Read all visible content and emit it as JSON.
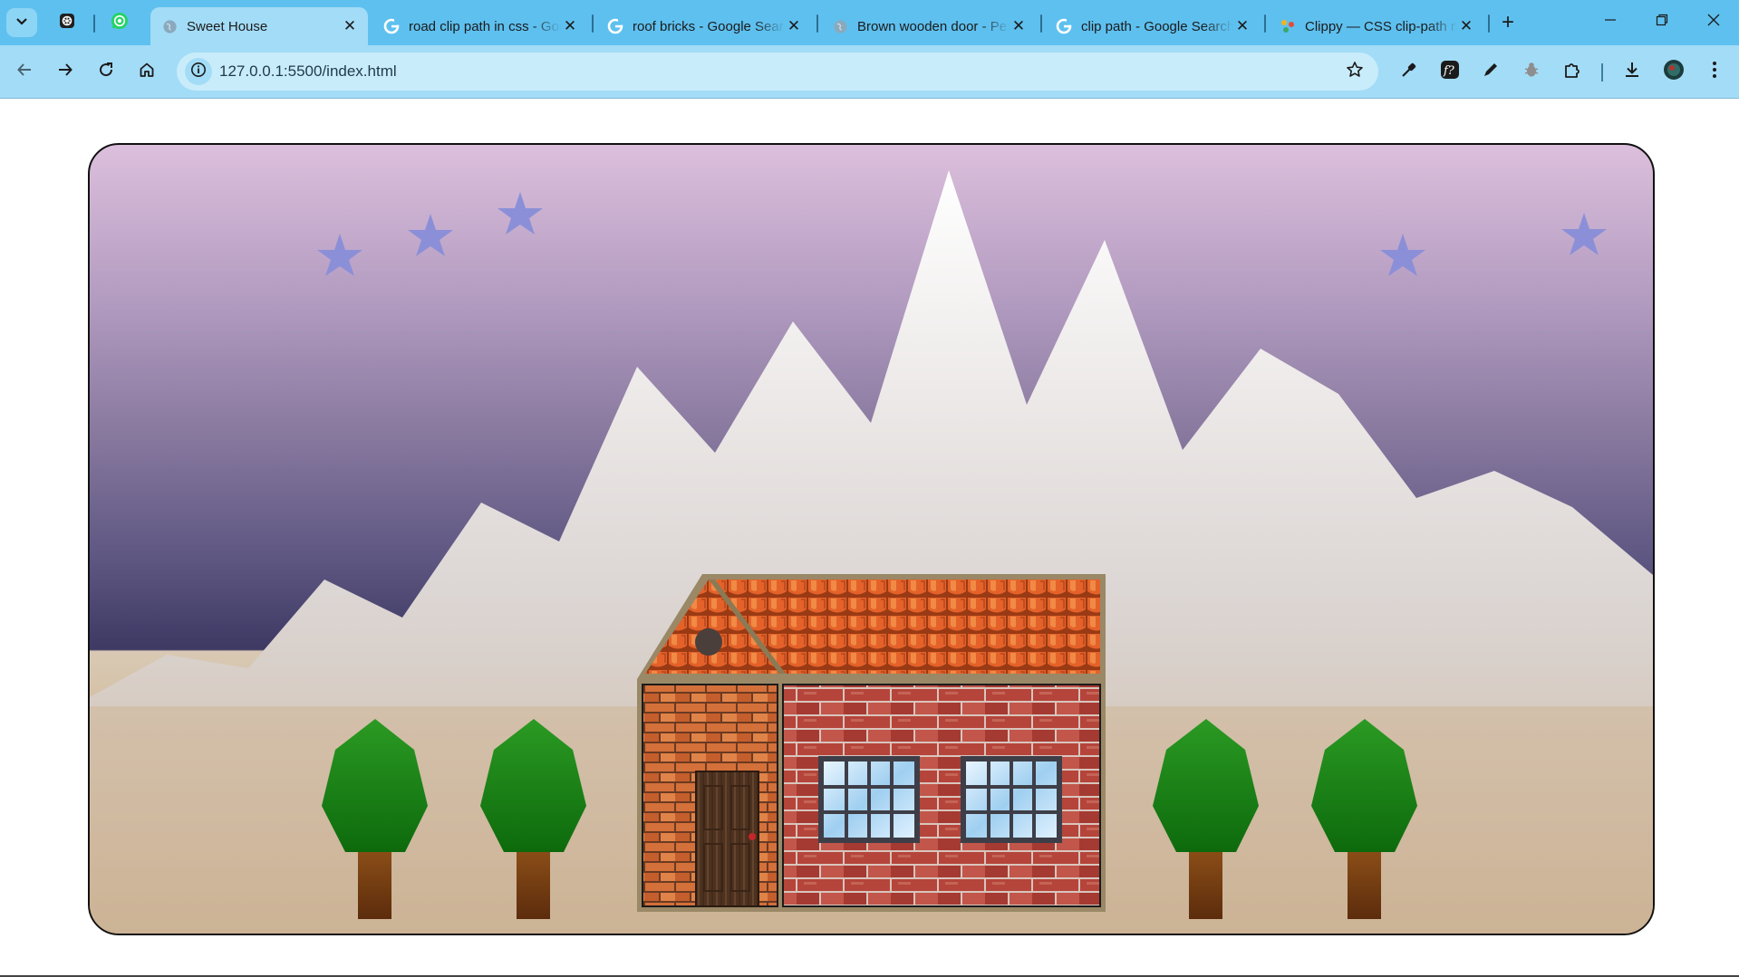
{
  "browser": {
    "tabs": [
      {
        "title": "Sweet House",
        "active": true
      },
      {
        "title": "road clip path in css - Google Search",
        "active": false
      },
      {
        "title": "roof bricks - Google Search",
        "active": false
      },
      {
        "title": "Brown wooden door - Pexels",
        "active": false
      },
      {
        "title": "clip path - Google Search",
        "active": false
      },
      {
        "title": "Clippy — CSS clip-path maker",
        "active": false
      }
    ],
    "new_tab_label": "+",
    "close_glyph": "✕",
    "url": "127.0.0.1:5500/index.html",
    "icons": [
      "tab-search-icon",
      "chatgpt-icon",
      "whatsapp-icon",
      "back-icon",
      "forward-icon",
      "reload-icon",
      "home-icon",
      "site-info-icon",
      "bookmark-star-icon",
      "eyedropper-icon",
      "font-icon",
      "pen-icon",
      "bug-icon",
      "extensions-icon",
      "download-icon",
      "profile-icon",
      "menu-icon",
      "minimize-icon",
      "restore-icon",
      "close-window-icon"
    ]
  },
  "scene": {
    "title": "Sweet House",
    "sky_colors": [
      "#dcbfdc",
      "#3d3963"
    ],
    "ground_colors": [
      "#d9c9b4",
      "#c9975a"
    ],
    "mountain_color": "#e8e6e4",
    "star_color": "#8b8fd8",
    "moon_color": "#d9d9d9",
    "roof_color": "#e4622a",
    "brick_color": "#b5443a",
    "tree_leaf_color": "#1a7d17",
    "tree_trunk_color": "#7a3e12",
    "window_glass_color": "#9fcff0",
    "door_color": "#4e3220",
    "stars_count": 5,
    "trees_count": 4,
    "windows_count": 2
  }
}
